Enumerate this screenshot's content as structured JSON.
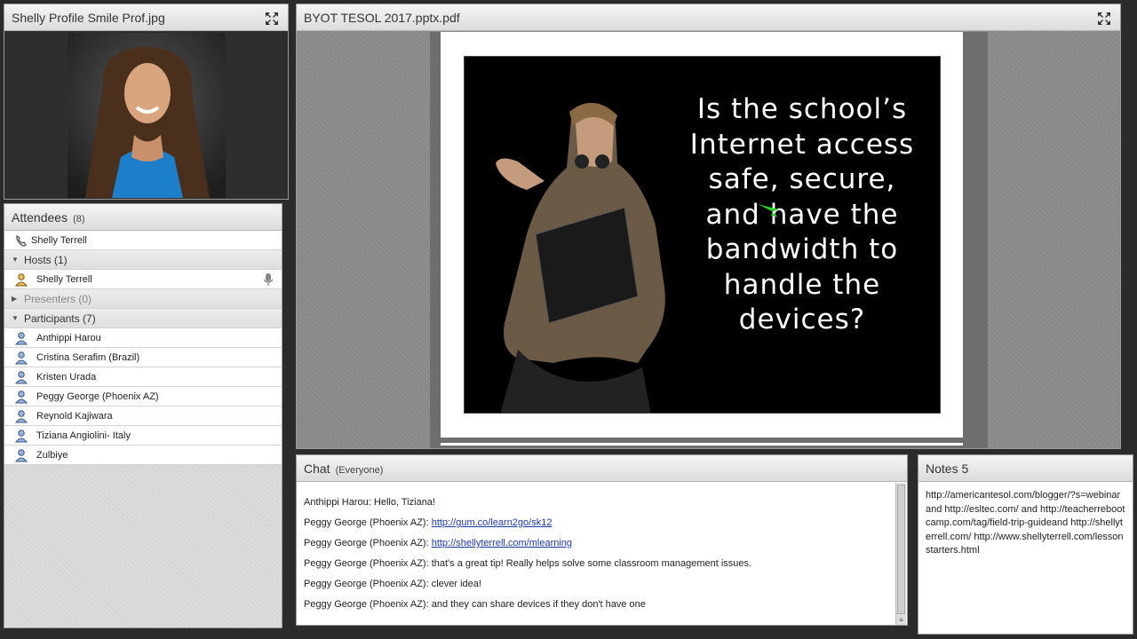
{
  "camera": {
    "title": "Shelly Profile Smile Prof.jpg"
  },
  "attendees": {
    "title": "Attendees",
    "count": "(8)",
    "me": "Shelly Terrell",
    "hosts_label": "Hosts (1)",
    "hosts": [
      "Shelly Terrell"
    ],
    "presenters_label": "Presenters (0)",
    "participants_label": "Participants (7)",
    "participants": [
      "Anthippi Harou",
      "Cristina Serafim (Brazil)",
      "Kristen Urada",
      "Peggy George (Phoenix AZ)",
      "Reynold Kajiwara",
      "Tiziana  Angiolini- Italy",
      "Zulbiye"
    ]
  },
  "share": {
    "title": "BYOT TESOL 2017.pptx.pdf",
    "slide_lines": [
      "Is the school’s",
      "Internet access",
      "safe, secure,",
      "and have the",
      "bandwidth to",
      "handle the",
      "devices?"
    ]
  },
  "chat": {
    "title": "Chat",
    "scope": "(Everyone)",
    "messages": [
      {
        "who": "Anthippi Harou:",
        "text": "Hello, Tiziana!",
        "link": ""
      },
      {
        "who": "Peggy George (Phoenix AZ):",
        "text": "",
        "link": "http://gum.co/learn2go/sk12"
      },
      {
        "who": "Peggy George (Phoenix AZ):",
        "text": "",
        "link": "http://shellyterrell.com/mlearning"
      },
      {
        "who": "Peggy George (Phoenix AZ):",
        "text": "that's a great tip! Really helps solve some classroom management issues.",
        "link": ""
      },
      {
        "who": "Peggy George (Phoenix AZ):",
        "text": "clever idea!",
        "link": ""
      },
      {
        "who": "Peggy George (Phoenix AZ):",
        "text": "and they can share devices if they don't have one",
        "link": ""
      }
    ]
  },
  "notes": {
    "title": "Notes 5",
    "body": "http://americantesol.com/blogger/?s=webinar and http://esltec.com/ and http://teacherrebootcamp.com/tag/field-trip-guideand http://shellyterrell.com/ http://www.shellyterrell.com/lessonstarters.html"
  }
}
